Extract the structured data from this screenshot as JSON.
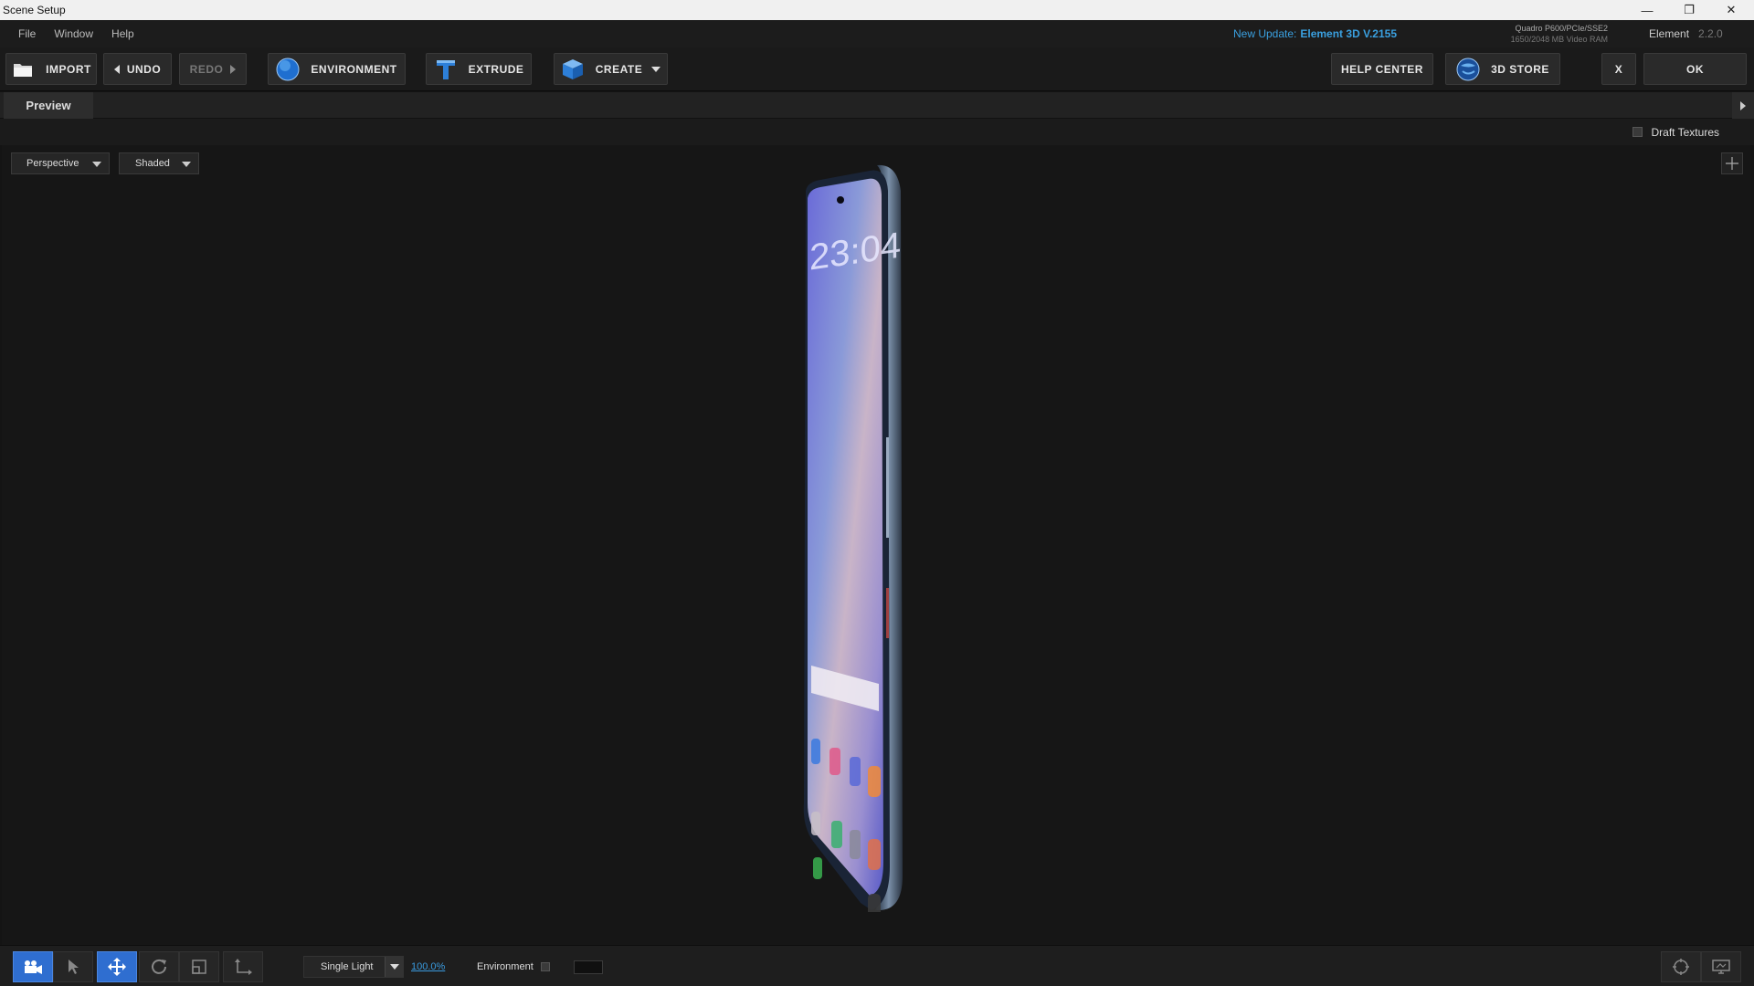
{
  "window": {
    "title": "Scene Setup",
    "controls": {
      "minimize": "—",
      "restore": "❐",
      "close": "✕"
    }
  },
  "menu": {
    "items": [
      "File",
      "Window",
      "Help"
    ],
    "update_prefix": "New Update:",
    "update_version": "Element 3D V.2155",
    "gpu_name": "Quadro P600/PCIe/SSE2",
    "gpu_vram": "1650/2048 MB Video RAM",
    "app_name": "Element",
    "app_version": "2.2.0"
  },
  "toolbar": {
    "import": "IMPORT",
    "undo": "UNDO",
    "redo": "REDO",
    "environment": "ENVIRONMENT",
    "extrude": "EXTRUDE",
    "create": "CREATE",
    "help_center": "HELP CENTER",
    "store": "3D STORE",
    "close": "X",
    "ok": "OK"
  },
  "tabs": {
    "preview": "Preview"
  },
  "options": {
    "draft_textures": "Draft Textures",
    "draft_textures_checked": false
  },
  "viewport": {
    "camera": "Perspective",
    "shading": "Shaded",
    "phone": {
      "time": "23:04"
    }
  },
  "bottom": {
    "light_mode": "Single Light",
    "light_intensity": "100.0%",
    "environment_label": "Environment",
    "environment_checked": false,
    "tools": [
      "camera-tool",
      "select-tool",
      "move-tool",
      "rotate-tool",
      "scale-tool",
      "axis-tool"
    ],
    "active_tool": "move-tool"
  },
  "colors": {
    "accent_blue": "#2f6ed0",
    "update_link": "#3aa0e0",
    "background": "#141414"
  }
}
